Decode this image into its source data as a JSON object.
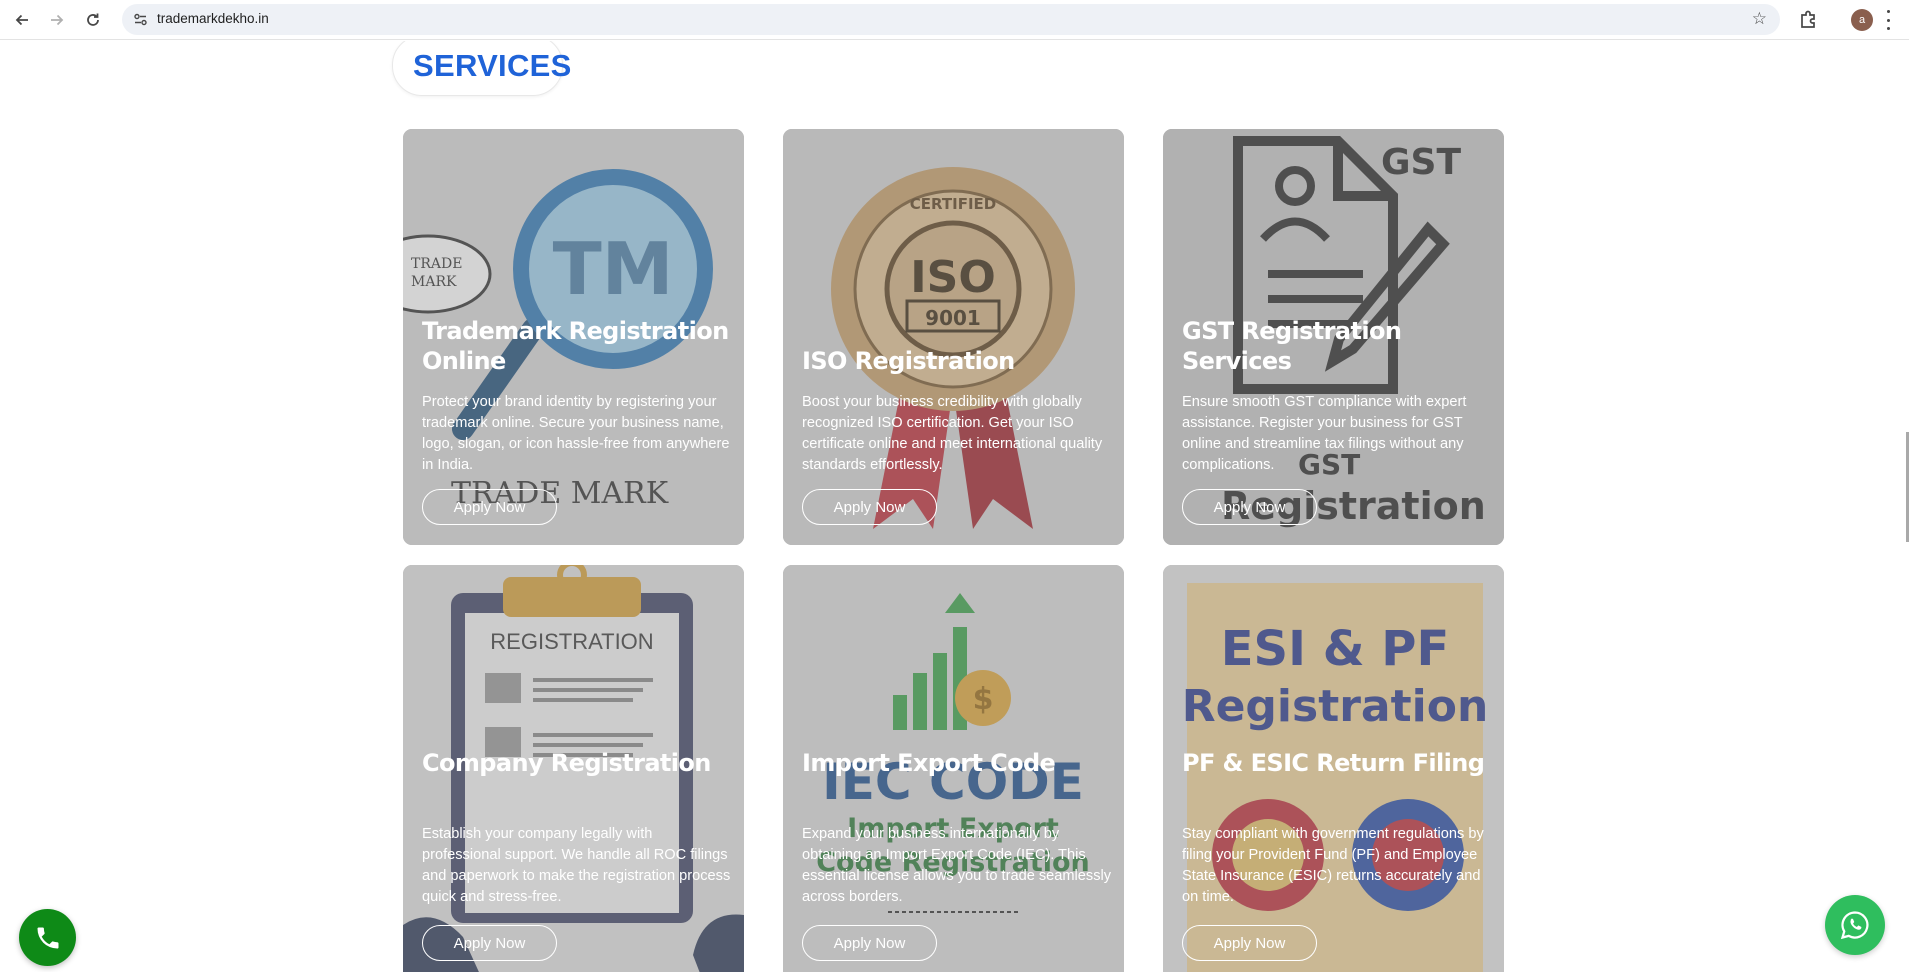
{
  "browser": {
    "url": "trademarkdekho.in",
    "profile_initial": "a"
  },
  "section": {
    "title": "SERVICES",
    "icon": "bolt-icon",
    "accent_color": "#1f63d8"
  },
  "cards": [
    {
      "title": "Trademark Registration Online",
      "description": "Protect your brand identity by registering your trademark online. Secure your business name, logo, slogan, or icon hassle-free from anywhere in India.",
      "button": "Apply Now",
      "art_text": [
        "TM",
        "TRADE",
        "MARK",
        "TRADE MARK"
      ]
    },
    {
      "title": "ISO Registration",
      "description": "Boost your business credibility with globally recognized ISO certification. Get your ISO certificate online and meet international quality standards effortlessly.",
      "button": "Apply Now",
      "art_text": [
        "ISO",
        "9001",
        "CERTIFIED"
      ]
    },
    {
      "title": "GST Registration Services",
      "description": "Ensure smooth GST compliance with expert assistance. Register your business for GST online and streamline tax filings without any complications.",
      "button": "Apply Now",
      "art_text": [
        "GST",
        "GST",
        "Registration"
      ]
    },
    {
      "title": "Company Registration",
      "description": "Establish your company legally with professional support. We handle all ROC filings and paperwork to make the registration process quick and stress-free.",
      "button": "Apply Now",
      "art_text": [
        "REGISTRATION"
      ]
    },
    {
      "title": "Import Export Code",
      "description": "Expand your business internationally by obtaining an Import Export Code (IEC). This essential license allows you to trade seamlessly across borders.",
      "button": "Apply Now",
      "art_text": [
        "IEC CODE",
        "Import Export",
        "Code Registration"
      ]
    },
    {
      "title": "PF & ESIC Return Filing",
      "description": "Stay compliant with government regulations by filing your Provident Fund (PF) and Employee State Insurance (ESIC) returns accurately and on time.",
      "button": "Apply Now",
      "art_text": [
        "ESI & PF",
        "Registration"
      ]
    }
  ],
  "floating": {
    "call_icon": "phone-icon",
    "whatsapp_icon": "whatsapp-icon",
    "call_color": "#0e8a17",
    "whatsapp_color": "#2fbe5e"
  }
}
